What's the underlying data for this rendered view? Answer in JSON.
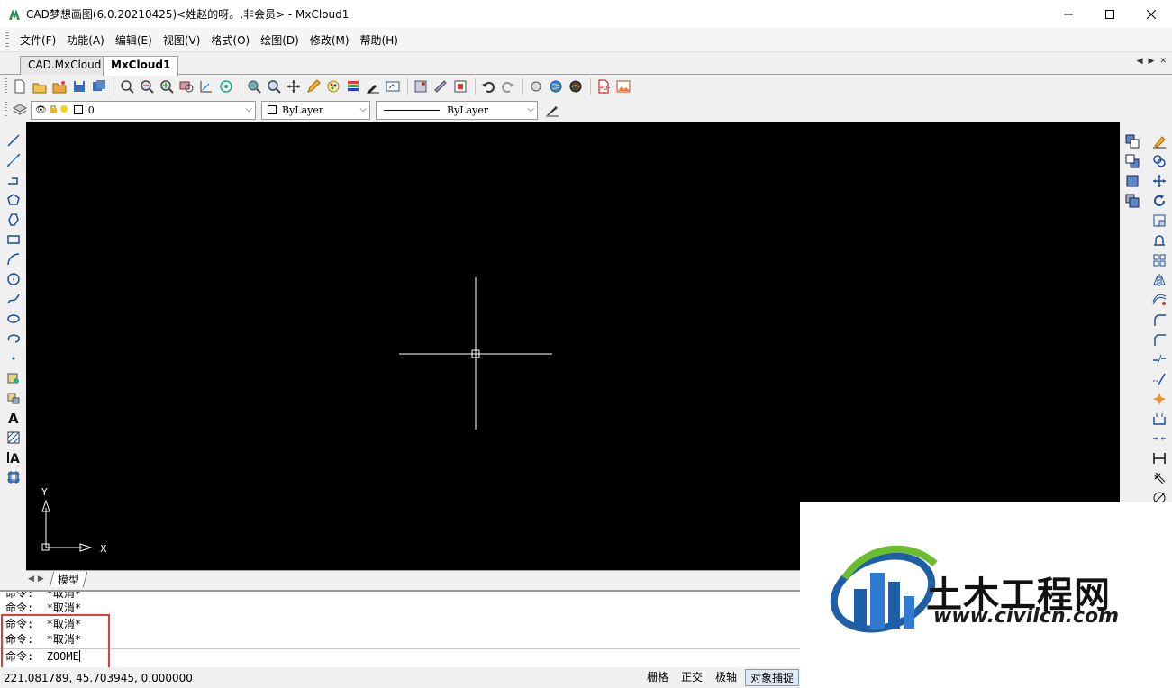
{
  "window": {
    "title": "CAD梦想画图(6.0.20210425)<姓赵的呀。,非会员> - MxCloud1",
    "min_icon": "minimize-icon",
    "max_icon": "maximize-icon",
    "close_icon": "close-icon"
  },
  "menu": [
    {
      "label": "文件(F)"
    },
    {
      "label": "功能(A)"
    },
    {
      "label": "编辑(E)"
    },
    {
      "label": "视图(V)"
    },
    {
      "label": "格式(O)"
    },
    {
      "label": "绘图(D)"
    },
    {
      "label": "修改(M)"
    },
    {
      "label": "帮助(H)"
    }
  ],
  "doc_tabs": [
    {
      "label": "CAD.MxCloud",
      "active": false
    },
    {
      "label": "MxCloud1",
      "active": true
    }
  ],
  "layer_bar": {
    "layer_value": "0",
    "color_value": "ByLayer",
    "linetype_value": "ByLayer"
  },
  "sheet_tabs": [
    {
      "label": "模型"
    }
  ],
  "command_history": [
    "命令:  *取消*",
    "命令:  *取消*",
    "命令:  *取消*",
    "命令:  *取消*"
  ],
  "command_prompt": "命令:",
  "command_input": "ZOOME",
  "status": {
    "coords": "221.081789,  45.703945,  0.000000",
    "buttons": [
      {
        "label": "栅格",
        "on": false
      },
      {
        "label": "正交",
        "on": false
      },
      {
        "label": "极轴",
        "on": false
      },
      {
        "label": "对象捕捉",
        "on": true
      }
    ]
  },
  "ucs": {
    "x_label": "X",
    "y_label": "Y"
  },
  "watermark": {
    "title": "土木工程网",
    "url": "www.civilcn.com"
  },
  "colors": {
    "canvas_bg": "#000000",
    "highlight_box": "#e23b3b",
    "accent_blue": "#1f5fa8"
  }
}
